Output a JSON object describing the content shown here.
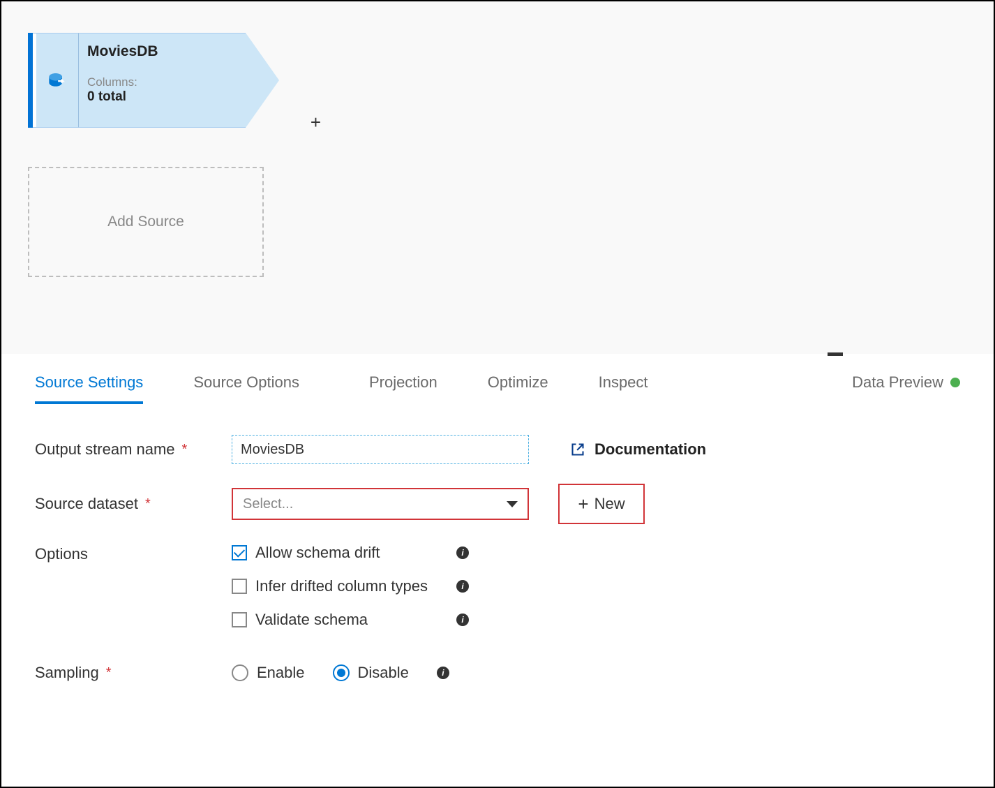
{
  "canvas": {
    "source_node": {
      "title": "MoviesDB",
      "columns_label": "Columns:",
      "columns_count": "0 total"
    },
    "add_source_label": "Add Source",
    "plus_connector": "+"
  },
  "tabs": [
    "Source Settings",
    "Source Options",
    "Projection",
    "Optimize",
    "Inspect",
    "Data Preview"
  ],
  "settings": {
    "output_stream_label": "Output stream name",
    "output_stream_value": "MoviesDB",
    "documentation_label": "Documentation",
    "source_dataset_label": "Source dataset",
    "source_dataset_placeholder": "Select...",
    "new_button_label": "New",
    "options_label": "Options",
    "option_allow_schema_drift": "Allow schema drift",
    "option_infer_drifted": "Infer drifted column types",
    "option_validate_schema": "Validate schema",
    "sampling_label": "Sampling",
    "sampling_enable": "Enable",
    "sampling_disable": "Disable"
  }
}
